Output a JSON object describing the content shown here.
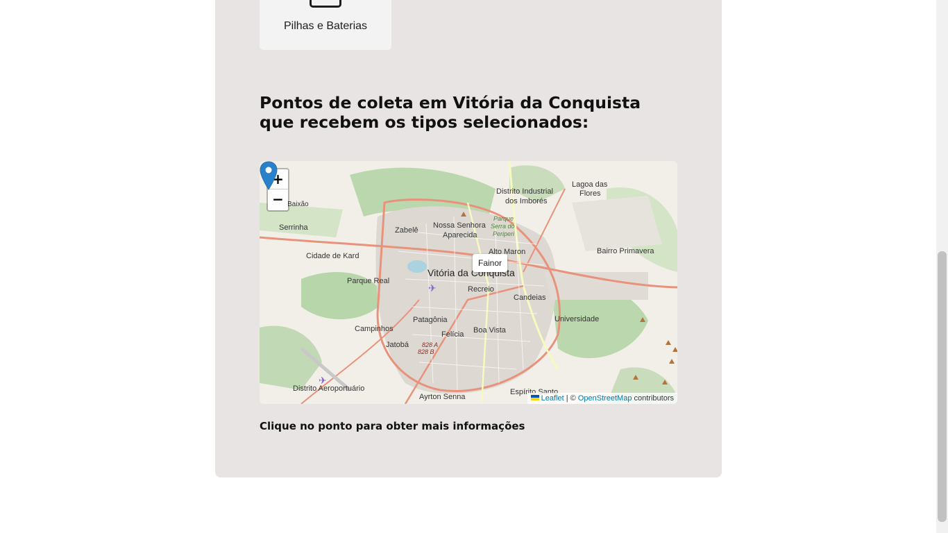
{
  "waste_type": {
    "label": "Pilhas e Baterias",
    "icon": "battery-icon"
  },
  "section": {
    "heading": "Pontos de coleta em Vitória da Conquista que recebem os tipos selecionados:",
    "hint": "Clique no ponto para obter mais informações"
  },
  "map": {
    "zoom_in": "+",
    "zoom_out": "−",
    "tooltip": "Fainor",
    "attribution": {
      "leaflet": "Leaflet",
      "separator": "| ©",
      "osm": "OpenStreetMap",
      "contributors": "contributors"
    },
    "labels": {
      "distrito_industrial_1": "Distrito Industrial",
      "distrito_industrial_2": "dos Imborés",
      "lagoa_1": "Lagoa das",
      "lagoa_2": "Flores",
      "baixao": "Baixão",
      "serrinha": "Serrinha",
      "zabele": "Zabelê",
      "nossa_senhora_1": "Nossa Senhora",
      "nossa_senhora_2": "Aparecida",
      "parque_1": "Parque",
      "parque_2": "Serra do",
      "parque_3": "Periperi",
      "alto_maron": "Alto Maron",
      "bairro_primavera": "Bairro Primavera",
      "cidade_de_kard": "Cidade de Kard",
      "vitoria": "Vitória da Conquista",
      "parque_real": "Parque Real",
      "recreio": "Recreio",
      "candeias": "Candeias",
      "patagonia": "Patagônia",
      "universidade": "Universidade",
      "campinhos": "Campinhos",
      "boa_vista": "Boa Vista",
      "felicia": "Felícia",
      "jatoba": "Jatobá",
      "road_1": "828 A",
      "road_2": "828 B",
      "distrito_aero": "Distrito Aeroportuário",
      "ayrton_senna": "Ayrton Senna",
      "espirito_santo": "Espírito Santo"
    }
  },
  "colors": {
    "card_bg": "#e9e4e4",
    "marker": "#2a81cb",
    "link": "#0078a8"
  }
}
